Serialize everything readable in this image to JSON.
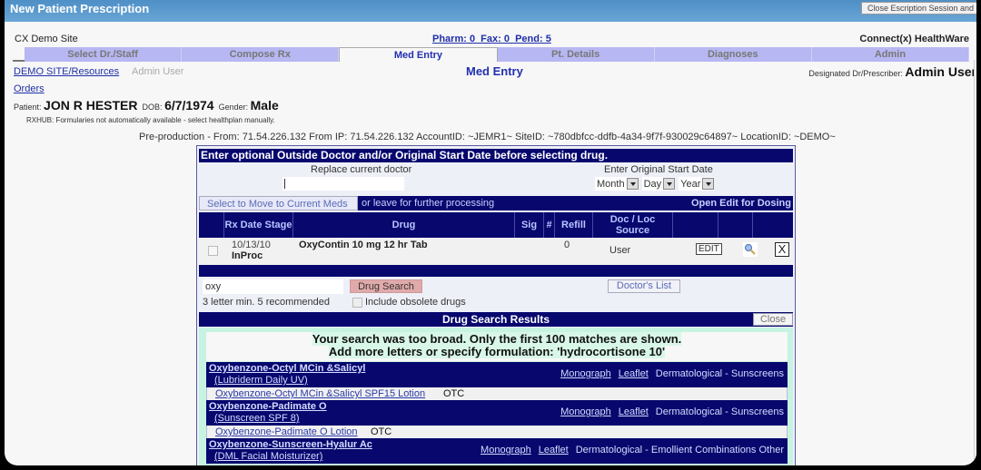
{
  "window": {
    "title": "New Patient Prescription",
    "close_session_label": "Close Escription Session and"
  },
  "header": {
    "site_name": "CX Demo Site",
    "pharm_status": "Pharm: 0  Fax: 0  Pend: 5",
    "brand": "Connect(x) HealthWare"
  },
  "tabs": [
    {
      "label": "Select Dr./Staff",
      "active": false
    },
    {
      "label": "Compose Rx",
      "active": false
    },
    {
      "label": "Med Entry",
      "active": true
    },
    {
      "label": "Pt. Details",
      "active": false
    },
    {
      "label": "Diagnoses",
      "active": false
    },
    {
      "label": "Admin",
      "active": false
    }
  ],
  "nav": {
    "demo_link": "DEMO SITE/Resources",
    "current_user": "Admin User",
    "orders_link": "Orders",
    "page_title": "Med Entry",
    "designated_label": "Designated Dr/Prescriber:",
    "designated_value": "Admin User"
  },
  "patient": {
    "label": "Patient:",
    "name": "JON R HESTER",
    "dob_label": "DOB:",
    "dob": "6/7/1974",
    "gender_label": "Gender:",
    "gender": "Male"
  },
  "notices": {
    "rxhub": "RXHUB: Formularies not automatically available - select healthplan manually.",
    "preprod": "Pre-production - From: 71.54.226.132 From IP: 71.54.226.132 AccountID: ~JEMR1~ SiteID: ~780dbfcc-ddfb-4a34-9f7f-930029c64897~ LocationID: ~DEMO~"
  },
  "panel": {
    "header": "Enter optional Outside Doctor and/or Original Start Date before selecting drug.",
    "replace_label": "Replace current doctor",
    "replace_value": "",
    "start_date_label": "Enter Original Start Date",
    "month": "Month",
    "day": "Day",
    "year": "Year",
    "move_button": "Select to Move to Current Meds",
    "leave_text": "or leave for further processing",
    "open_edit": "Open Edit for Dosing"
  },
  "rx_table": {
    "columns": [
      "",
      "Rx Date Stage",
      "Drug",
      "Sig",
      "#",
      "Refill",
      "Doc / Loc Source",
      "",
      "",
      ""
    ],
    "rows": [
      {
        "checked": false,
        "date": "10/13/10",
        "stage": "InProc",
        "drug": "OxyContin 10 mg 12 hr Tab",
        "sig": "",
        "qty": "",
        "refill": "0",
        "source": "User",
        "edit_label": "EDIT",
        "view_icon": "magnifier-icon",
        "delete_label": "X"
      }
    ]
  },
  "drug_search": {
    "query": "oxy",
    "button": "Drug Search",
    "hint": "3 letter min. 5 recommended",
    "obsolete_label": "Include obsolete drugs",
    "obsolete_checked": false,
    "doctors_list": "Doctor's List",
    "results_header": "Drug Search Results",
    "close_label": "Close",
    "too_broad_line1": "Your search was too broad. Only the first 100 matches are shown.",
    "too_broad_line2": "Add more letters or specify formulation: 'hydrocortisone 10'"
  },
  "results": [
    {
      "generic": "Oxybenzone-Octyl MCin &Salicyl",
      "brand": "(Lubriderm Daily UV)",
      "monograph": "Monograph",
      "leaflet": "Leaflet",
      "category": "Dermatological - Sunscreens",
      "product": "Oxybenzone-Octyl MCin &Salicyl SPF15 Lotion",
      "otc": "OTC"
    },
    {
      "generic": "Oxybenzone-Padimate O",
      "brand": "(Sunscreen SPF 8)",
      "monograph": "Monograph",
      "leaflet": "Leaflet",
      "category": "Dermatological - Sunscreens",
      "product": "Oxybenzone-Padimate O Lotion",
      "otc": "OTC"
    },
    {
      "generic": "Oxybenzone-Sunscreen-Hyalur Ac",
      "brand": "(DML Facial Moisturizer)",
      "monograph": "Monograph",
      "leaflet": "Leaflet",
      "category": "Dermatological - Emollient Combinations Other",
      "product": "",
      "otc": ""
    }
  ]
}
